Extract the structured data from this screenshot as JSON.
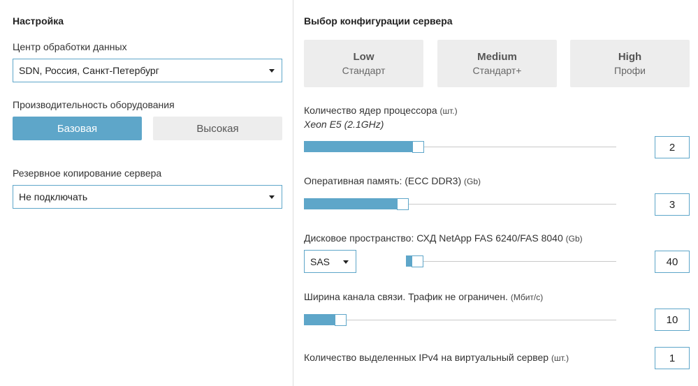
{
  "settings": {
    "title": "Настройка",
    "datacenter": {
      "label": "Центр обработки данных",
      "value": "SDN, Россия, Санкт-Петербург"
    },
    "performance": {
      "label": "Производительность оборудования",
      "options": [
        "Базовая",
        "Высокая"
      ],
      "selected": "Базовая"
    },
    "backup": {
      "label": "Резервное копирование сервера",
      "value": "Не подключать"
    }
  },
  "config": {
    "title": "Выбор конфигурации сервера",
    "presets": [
      {
        "name": "Low",
        "sub": "Стандарт"
      },
      {
        "name": "Medium",
        "sub": "Стандарт+"
      },
      {
        "name": "High",
        "sub": "Профи"
      }
    ],
    "cpu": {
      "label": "Количество ядер процессора",
      "unit": "(шт.)",
      "sublabel": "Xeon E5 (2.1GHz)",
      "value": "2",
      "level": 0.35
    },
    "ram": {
      "label": "Оперативная память: (ECC DDR3)",
      "unit": "(Gb)",
      "value": "3",
      "level": 0.3
    },
    "disk": {
      "label": "Дисковое пространство: СХД NetApp FAS 6240/FAS 8040",
      "unit": "(Gb)",
      "type": "SAS",
      "value": "40",
      "level": 0.03
    },
    "bandwidth": {
      "label": "Ширина канала связи. Трафик не ограничен.",
      "unit": "(Мбит/с)",
      "value": "10",
      "level": 0.1
    },
    "ipv4": {
      "label": "Количество выделенных IPv4 на виртуальный сервер",
      "unit": "(шт.)",
      "value": "1"
    }
  },
  "colors": {
    "accent": "#5ea6c9",
    "inactive": "#ededed",
    "divider": "#dcdcdc"
  }
}
